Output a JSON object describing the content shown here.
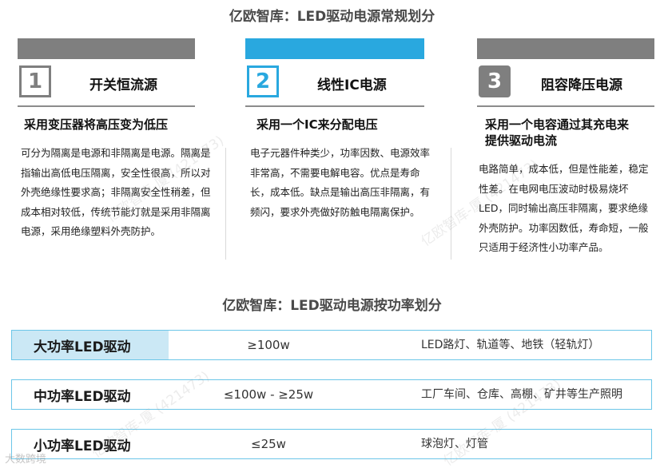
{
  "titles": {
    "classification": "亿欧智库：LED驱动电源常规划分",
    "power": "亿欧智库：LED驱动电源按功率划分"
  },
  "colors": {
    "gray_bar": "#7f7f7f",
    "blue_bar": "#29a8df",
    "gray_num": "#7f7f7f",
    "row_label_bg": "#cbe8f5",
    "row_border": "#6cc6e8"
  },
  "categories": [
    {
      "number": "1",
      "heading": "开关恒流源",
      "subtitle": "采用变压器将高压变为低压",
      "body": "可分为隔离是电源和非隔离是电源。隔离是指输出高低电压隔离，安全性很高，所以对外壳绝缘性要求高；非隔离安全性稍差，但成本相对较低，传统节能灯就是采用非隔离电源，采用绝缘塑料外壳防护。"
    },
    {
      "number": "2",
      "heading": "线性IC电源",
      "subtitle": "采用一个IC来分配电压",
      "body": "电子元器件种类少，功率因数、电源效率非常高，不需要电解电容。优点是寿命长，成本低。缺点是输出高压非隔离，有频闪，要求外壳做好防触电隔离保护。"
    },
    {
      "number": "3",
      "heading": "阻容降压电源",
      "subtitle": "采用一个电容通过其充电来提供驱动电流",
      "body": "电路简单，成本低，但是性能差，稳定性差。在电网电压波动时极易烧坏LED，同时输出高压非隔离，要求绝缘外壳防护。功率因数低，寿命短，一般只适用于经济性小功率产品。"
    }
  ],
  "power_rows": [
    {
      "label": "大功率LED驱动",
      "range": "≥100w",
      "applications": "LED路灯、轨道等、地铁（轻轨灯）"
    },
    {
      "label": "中功率LED驱动",
      "range": "≤100w - ≥25w",
      "applications": "工厂车间、仓库、高棚、矿井等生产照明"
    },
    {
      "label": "小功率LED驱动",
      "range": "≤25w",
      "applications": "球泡灯、灯管"
    }
  ],
  "watermarks": {
    "center": "亿欧智库-厦 (421473)",
    "corner": "大数跨境"
  }
}
